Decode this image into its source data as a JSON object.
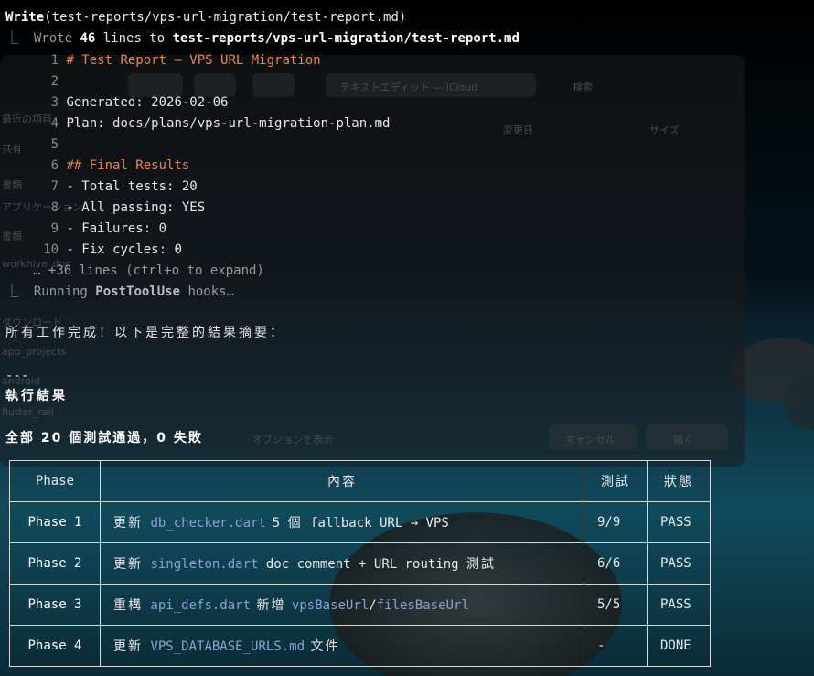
{
  "write_header": {
    "tool": "Write",
    "args": "(test-reports/vps-url-migration/test-report.md)"
  },
  "wrote_line": {
    "prefix": "⎿  Wrote ",
    "count": "46",
    "mid": " lines to ",
    "path": "test-reports/vps-url-migration/test-report.md"
  },
  "file_lines": [
    {
      "num": "1",
      "text": "# Test Report — VPS URL Migration"
    },
    {
      "num": "2",
      "text": ""
    },
    {
      "num": "3",
      "text": "Generated: 2026-02-06"
    },
    {
      "num": "4",
      "text": "Plan: docs/plans/vps-url-migration-plan.md"
    },
    {
      "num": "5",
      "text": ""
    },
    {
      "num": "6",
      "text": "## Final Results"
    },
    {
      "num": "7",
      "text": "- Total tests: 20"
    },
    {
      "num": "8",
      "text": "- All passing: YES"
    },
    {
      "num": "9",
      "text": "- Failures: 0"
    },
    {
      "num": "10",
      "text": "- Fix cycles: 0"
    }
  ],
  "expand_hint": "… +36 lines (ctrl+o to expand)",
  "hooks_line": {
    "prefix": "⎿  Running ",
    "name": "PostToolUse",
    "suffix": " hooks…"
  },
  "summary_intro": "所有工作完成！以下是完整的結果摘要：",
  "hr": "---",
  "section_title": "執行結果",
  "all_passed": "全部 20 個測試通過，0 失敗",
  "table": {
    "headers": [
      "Phase",
      "內容",
      "測試",
      "狀態"
    ],
    "rows": [
      {
        "phase": "Phase 1",
        "verb": "更新",
        "file": "db_checker.dart",
        "rest_a": " 5 個",
        "rest_b": " fallback URL → VPS",
        "tests": "9/9",
        "status": "PASS"
      },
      {
        "phase": "Phase 2",
        "verb": "更新",
        "file": "singleton.dart",
        "rest_a": " doc comment + URL routing ",
        "rest_b": "測試",
        "tests": "6/6",
        "status": "PASS"
      },
      {
        "phase": "Phase 3",
        "verb": "重構",
        "file": "api_defs.dart",
        "rest_a": " 新增 ",
        "file2": "vpsBaseUrl",
        "sep": "/",
        "file3": "filesBaseUrl",
        "tests": "5/5",
        "status": "PASS"
      },
      {
        "phase": "Phase 4",
        "verb": "更新",
        "file": "VPS_DATABASE_URLS.md",
        "rest_a": " 文件",
        "tests": "-",
        "status": "DONE"
      }
    ]
  },
  "ghost_finder": {
    "location": "テキストエディット — iCloud",
    "search": "検索",
    "col_date": "変更日",
    "col_size": "サイズ",
    "sidebar": [
      "最近の項目",
      "共有",
      "書類",
      "アプリケーション",
      "書類",
      "workhive_doc",
      "ダウンロード",
      "app_projects",
      "android",
      "flutter_rail"
    ],
    "show_options": "オプションを表示",
    "cancel": "キャンセル",
    "open": "開く"
  },
  "colors": {
    "accent_orange": "#e9874f",
    "code_blue": "#8ea1d6",
    "dim": "#9a9a9a"
  }
}
